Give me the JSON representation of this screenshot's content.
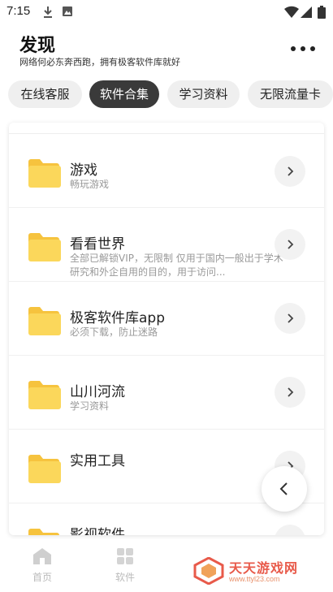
{
  "status_bar": {
    "time": "7:15",
    "icons": [
      "download-icon",
      "image-icon",
      "wifi-icon",
      "cellular-icon",
      "battery-icon"
    ]
  },
  "header": {
    "title": "发现",
    "subtitle": "网络何必东奔西跑，拥有极客软件库就好",
    "more_icon": "more-horizontal-icon"
  },
  "tabs": [
    {
      "label": "在线客服",
      "active": false
    },
    {
      "label": "软件合集",
      "active": true
    },
    {
      "label": "学习资料",
      "active": false
    },
    {
      "label": "无限流量卡",
      "active": false
    }
  ],
  "list": [
    {
      "title": "游戏",
      "desc": "畅玩游戏"
    },
    {
      "title": "看看世界",
      "desc": "全部已解锁VIP，无限制 仅用于国内一般出于学术研究和外企自用的目的，用于访问..."
    },
    {
      "title": "极客软件库app",
      "desc": "必须下载，防止迷路"
    },
    {
      "title": "山川河流",
      "desc": "学习资料"
    },
    {
      "title": "实用工具",
      "desc": ""
    },
    {
      "title": "影视软件",
      "desc": ""
    }
  ],
  "bottom_nav": [
    {
      "label": "首页",
      "icon": "home-icon"
    },
    {
      "label": "软件",
      "icon": "apps-grid-icon"
    }
  ],
  "watermark": {
    "title": "天天游戏网",
    "url": "www.ttyl23.com"
  },
  "colors": {
    "folder": "#fbd75b",
    "folder_tab": "#f6c33e",
    "active_tab_bg": "#3a3a3a",
    "tab_bg": "#efefef",
    "watermark": "#e85a4a"
  }
}
